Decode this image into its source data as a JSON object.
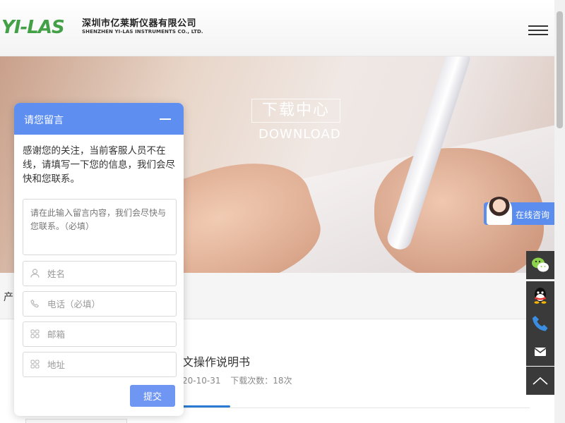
{
  "header": {
    "logo_mark": "YI-LAS",
    "company_cn": "深圳市亿莱斯仪器有限公司",
    "company_en": "SHENZHEN YI-LAS INSTRUMENTS CO., LTD."
  },
  "banner": {
    "title_cn": "下载中心",
    "title_en": "DOWNLOAD"
  },
  "breadcrumb": {
    "text": "产"
  },
  "document": {
    "title": "文操作说明书",
    "date": "20-10-31",
    "downloads": "下载次数：18次"
  },
  "message_widget": {
    "title": "请您留言",
    "intro": "感谢您的关注，当前客服人员不在线，请填写一下您的信息，我们会尽快和您联系。",
    "textarea_placeholder": "请在此输入留言内容，我们会尽快与您联系。（必填）",
    "fields": [
      {
        "icon": "person-icon",
        "placeholder": "姓名"
      },
      {
        "icon": "phone-icon",
        "placeholder": "电话（必填）"
      },
      {
        "icon": "grid-icon",
        "placeholder": "邮箱"
      },
      {
        "icon": "grid-icon",
        "placeholder": "地址"
      }
    ],
    "submit": "提交"
  },
  "consult": {
    "label": "在线咨询"
  },
  "side_toolbar": [
    "wechat-icon",
    "qq-icon",
    "phone-icon",
    "mail-icon",
    "back-to-top-icon"
  ],
  "colors": {
    "accent": "#5d8ef0",
    "logo_green": "#43a047",
    "toolbar_bg": "#3a3a3a"
  }
}
